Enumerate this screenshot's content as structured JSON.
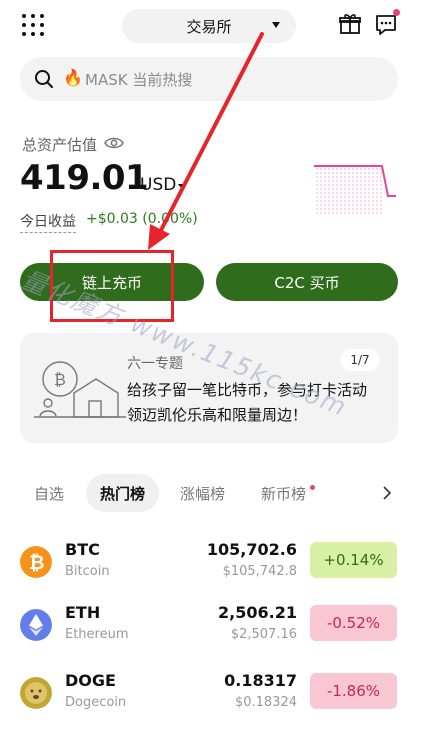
{
  "header": {
    "exchange_label": "交易所",
    "icons": [
      "grid-menu-icon",
      "gift-icon",
      "message-icon"
    ],
    "notification_dot_color": "#e3476b"
  },
  "search": {
    "placeholder": "MASK 当前热搜",
    "icon": "search-icon",
    "hot_icon": "🔥"
  },
  "assets": {
    "label": "总资产估值",
    "value": "419.01",
    "unit": "USD",
    "pnl_label": "今日收益",
    "pnl_value": "+$0.03 (0.00%)",
    "pnl_color": "#2c7a1e",
    "sparkline_color": "#e9449b"
  },
  "actions": {
    "deposit_label": "链上充币",
    "c2c_label": "C2C 买币",
    "button_color": "#2f6c1b"
  },
  "banner": {
    "tag": "六一专题",
    "pager": "1/7",
    "line1": "给孩子留一笔比特币，参与打卡活动",
    "line2": "领迈凯伦乐高和限量周边！"
  },
  "tabs": [
    {
      "label": "自选",
      "active": false
    },
    {
      "label": "热门榜",
      "active": true
    },
    {
      "label": "涨幅榜",
      "active": false
    },
    {
      "label": "新币榜",
      "active": false,
      "dot": true
    }
  ],
  "coins": [
    {
      "symbol": "BTC",
      "name": "Bitcoin",
      "price": "105,702.6",
      "usd": "$105,742.8",
      "change": "+0.14%",
      "direction": "up",
      "icon": "bitcoin-icon",
      "icon_color": "#f7931a"
    },
    {
      "symbol": "ETH",
      "name": "Ethereum",
      "price": "2,506.21",
      "usd": "$2,507.16",
      "change": "-0.52%",
      "direction": "down",
      "icon": "ethereum-icon",
      "icon_color": "#627eea"
    },
    {
      "symbol": "DOGE",
      "name": "Dogecoin",
      "price": "0.18317",
      "usd": "$0.18324",
      "change": "-1.86%",
      "direction": "down",
      "icon": "dogecoin-icon",
      "icon_color": "#c2a633"
    }
  ],
  "overlay": {
    "annotation_color": "#e5242b",
    "watermark": "量化魔方 www.115kc.com"
  }
}
